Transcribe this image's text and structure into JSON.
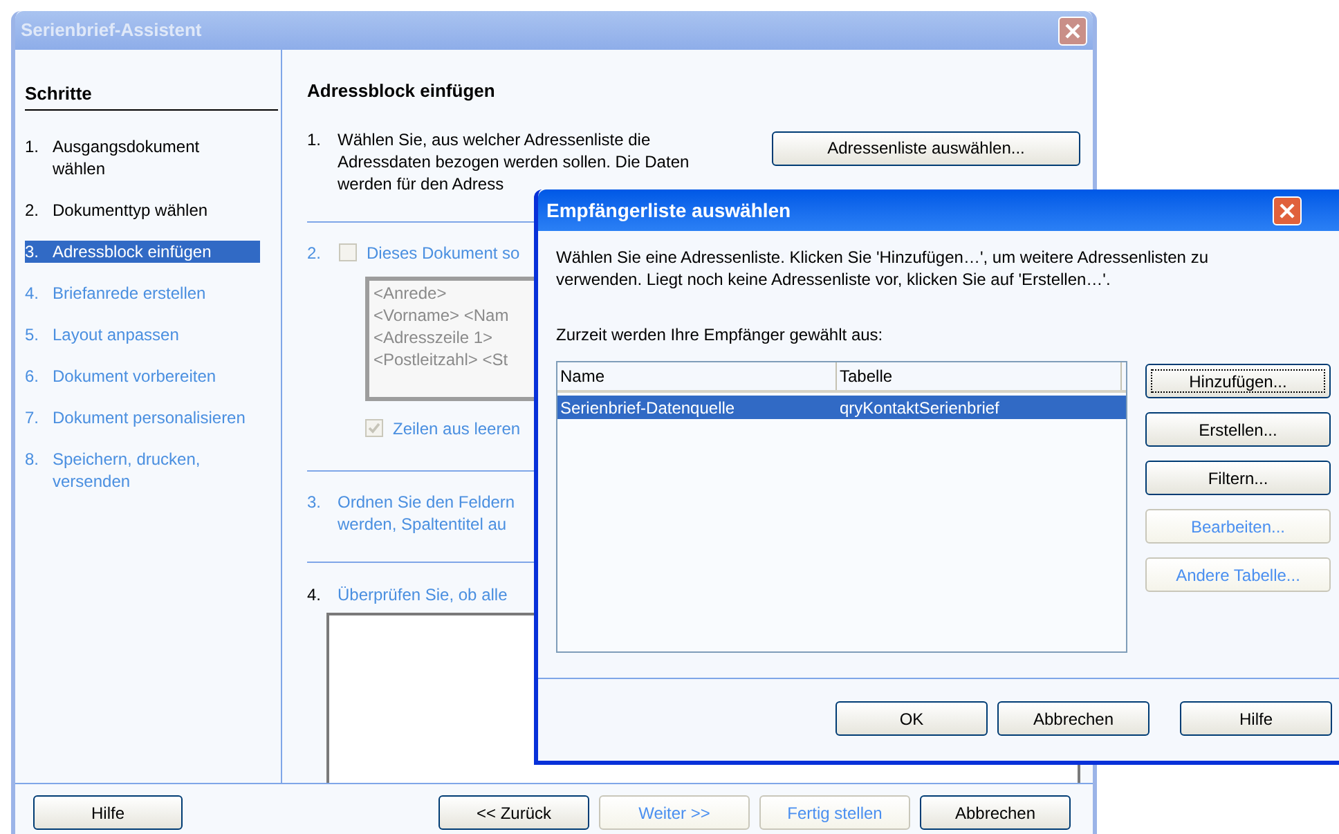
{
  "wizard": {
    "title": "Serienbrief-Assistent",
    "active": false,
    "steps_heading": "Schritte",
    "steps": [
      {
        "number": "1.",
        "lines": [
          "Ausgangsdokument",
          "wählen"
        ],
        "selected": false,
        "enabled": true
      },
      {
        "number": "2.",
        "lines": [
          "Dokumenttyp wählen"
        ],
        "selected": false,
        "enabled": true
      },
      {
        "number": "3.",
        "lines": [
          "Adressblock einfügen"
        ],
        "selected": true,
        "enabled": true
      },
      {
        "number": "4.",
        "lines": [
          "Briefanrede erstellen"
        ],
        "selected": false,
        "enabled": false
      },
      {
        "number": "5.",
        "lines": [
          "Layout anpassen"
        ],
        "selected": false,
        "enabled": false
      },
      {
        "number": "6.",
        "lines": [
          "Dokument vorbereiten"
        ],
        "selected": false,
        "enabled": false
      },
      {
        "number": "7.",
        "lines": [
          "Dokument personalisieren"
        ],
        "selected": false,
        "enabled": false
      },
      {
        "number": "8.",
        "lines": [
          "Speichern, drucken,",
          "versenden"
        ],
        "selected": false,
        "enabled": false
      }
    ],
    "page_title": "Adressblock einfügen",
    "section1": {
      "number": "1.",
      "lines": [
        "Wählen Sie, aus welcher Adressenliste die",
        "Adressdaten bezogen werden sollen. Die Daten",
        "werden für den Adress"
      ],
      "button": "Adressenliste auswählen..."
    },
    "section2": {
      "number": "2.",
      "enabled": false,
      "checkbox": {
        "label": "Dieses Dokument so",
        "checked": false
      },
      "preview_lines": [
        "<Anrede>",
        "<Vorname> <Nam",
        "<Adresszeile 1>",
        "<Postleitzahl> <St"
      ],
      "option": {
        "label": "Zeilen aus leeren",
        "checked": true
      }
    },
    "section3": {
      "number": "3.",
      "enabled": false,
      "lines": [
        "Ordnen Sie den Feldern",
        "werden, Spaltentitel au"
      ]
    },
    "section4": {
      "number": "4.",
      "enabled": false,
      "text": "Überprüfen Sie, ob alle"
    },
    "help_button": "Hilfe",
    "nav_buttons": [
      {
        "label": "<< Zurück",
        "enabled": true
      },
      {
        "label": "Weiter >>",
        "enabled": false
      },
      {
        "label": "Fertig stellen",
        "enabled": false
      },
      {
        "label": "Abbrechen",
        "enabled": true
      }
    ]
  },
  "dialog": {
    "title": "Empfängerliste auswählen",
    "active": true,
    "intro": "Wählen Sie eine Adressenliste. Klicken Sie 'Hinzufügen…', um weitere Adressenlisten zu verwenden. Liegt noch keine Adressenliste vor, klicken Sie auf 'Erstellen…'.",
    "current_label": "Zurzeit werden Ihre Empfänger gewählt aus:",
    "columns": [
      "Name",
      "Tabelle"
    ],
    "rows": [
      {
        "cells": [
          "Serienbrief-Datenquelle",
          "qryKontaktSerienbrief"
        ],
        "selected": true
      }
    ],
    "side_buttons": [
      {
        "label": "Hinzufügen...",
        "enabled": true,
        "focused": true
      },
      {
        "label": "Erstellen...",
        "enabled": true,
        "focused": false
      },
      {
        "label": "Filtern...",
        "enabled": true,
        "focused": false
      },
      {
        "label": "Bearbeiten...",
        "enabled": false,
        "focused": false
      },
      {
        "label": "Andere Tabelle...",
        "enabled": false,
        "focused": false
      }
    ],
    "buttons": [
      "OK",
      "Abbrechen",
      "Hilfe"
    ]
  }
}
